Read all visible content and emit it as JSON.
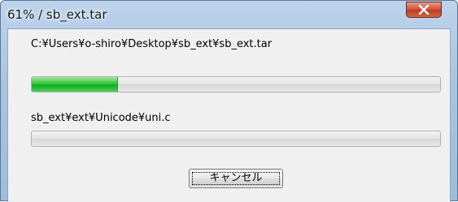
{
  "window": {
    "title": "61% / sb_ext.tar"
  },
  "archive": {
    "path": "C:¥Users¥o-shiro¥Desktop¥sb_ext¥sb_ext.tar",
    "progress": 0.21
  },
  "file": {
    "path": "sb_ext¥ext¥Unicode¥uni.c",
    "progress": 0
  },
  "buttons": {
    "cancel_label": "キャンセル"
  },
  "colors": {
    "progress_green": "#06b025",
    "close_red": "#c03a22"
  }
}
